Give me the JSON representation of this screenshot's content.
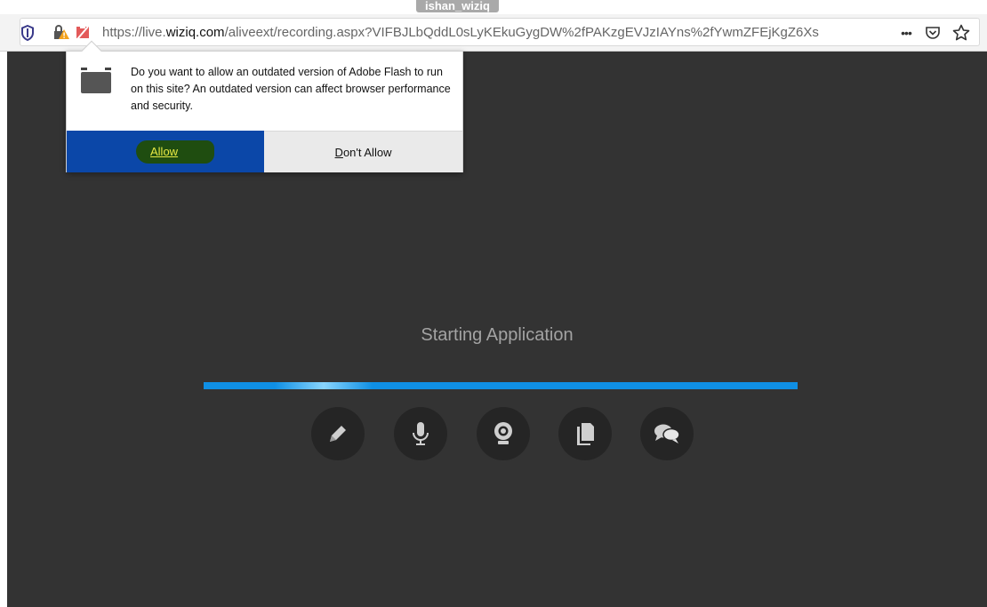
{
  "caption": {
    "overlay_name": "ishan_wiziq"
  },
  "browser": {
    "url_prefix": "https://live.",
    "url_domain": "wiziq.com",
    "url_rest": "/aliveext/recording.aspx?VIFBJLbQddL0sLyKEkuGygDW%2fPAKzgEVJzIAYns%2fYwmZFEjKgZ6Xs",
    "icons": [
      "shield-icon",
      "lock-warning-icon",
      "plugin-blocked-icon",
      "more-icon",
      "pocket-icon",
      "bookmark-star-icon"
    ],
    "more_label": "•••"
  },
  "popup": {
    "message": "Do you want to allow an outdated version of Adobe Flash to run on this site? An outdated version can affect browser performance and security.",
    "allow_label": "Allow",
    "deny_label_first": "D",
    "deny_label_rest": "on't Allow",
    "accent_color": "#0b47a8"
  },
  "app": {
    "status": "Starting Application",
    "progress_color": "#0f8fe4",
    "feature_icons": [
      "pencil-icon",
      "microphone-icon",
      "webcam-icon",
      "document-icon",
      "chat-icon"
    ]
  }
}
